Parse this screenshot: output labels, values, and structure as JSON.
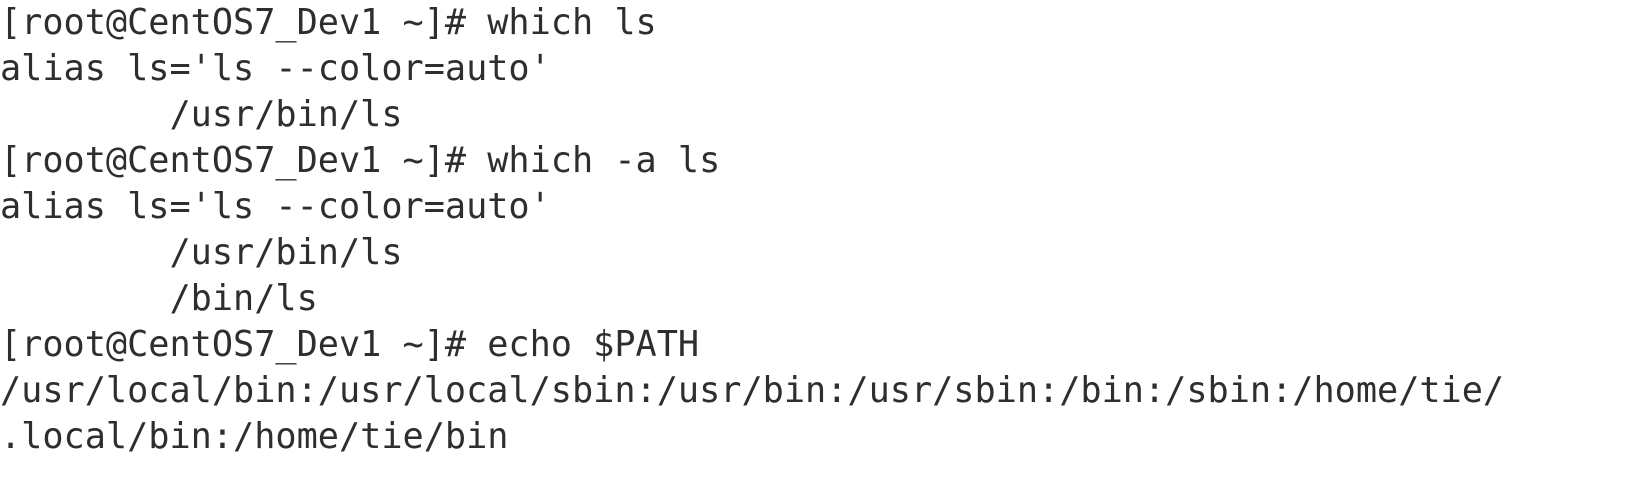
{
  "terminal": {
    "lines": [
      "[root@CentOS7_Dev1 ~]# which ls",
      "alias ls='ls --color=auto'",
      "        /usr/bin/ls",
      "[root@CentOS7_Dev1 ~]# which -a ls",
      "alias ls='ls --color=auto'",
      "        /usr/bin/ls",
      "        /bin/ls",
      "[root@CentOS7_Dev1 ~]# echo $PATH",
      "/usr/local/bin:/usr/local/sbin:/usr/bin:/usr/sbin:/bin:/sbin:/home/tie/",
      ".local/bin:/home/tie/bin"
    ],
    "text_color": "#2e2e2e",
    "background_color": "#ffffff"
  }
}
